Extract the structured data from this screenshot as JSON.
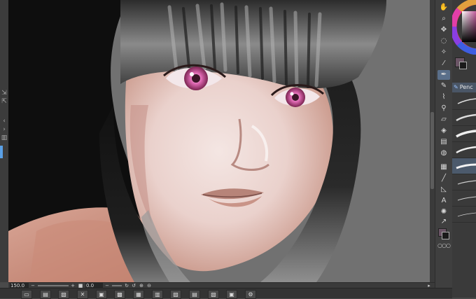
{
  "status_bar": {
    "zoom_value": "150.0",
    "rotation_value": "0.0"
  },
  "subtool": {
    "active_tab_label": "Penc",
    "group_icon": "pencil-icon"
  },
  "tools": [
    {
      "name": "hand-tool",
      "icon": "hand-icon",
      "glyph": "✋"
    },
    {
      "name": "zoom-tool",
      "icon": "magnifier-icon",
      "glyph": "⌕"
    },
    {
      "name": "move-tool",
      "icon": "move-icon",
      "glyph": "✥"
    },
    {
      "name": "lasso-tool",
      "icon": "lasso-icon",
      "glyph": "◌"
    },
    {
      "name": "magic-wand-tool",
      "icon": "wand-icon",
      "glyph": "✧"
    },
    {
      "name": "eyedropper-tool",
      "icon": "eyedropper-icon",
      "glyph": "⁄"
    },
    {
      "name": "pen-tool",
      "icon": "pen-icon",
      "glyph": "✒"
    },
    {
      "name": "pencil-tool",
      "icon": "pencil-icon",
      "glyph": "✎"
    },
    {
      "name": "brush-tool",
      "icon": "brush-icon",
      "glyph": "⌇"
    },
    {
      "name": "airbrush-tool",
      "icon": "airbrush-icon",
      "glyph": "⚲"
    },
    {
      "name": "eraser-tool",
      "icon": "eraser-icon",
      "glyph": "▱"
    },
    {
      "name": "fill-tool",
      "icon": "bucket-icon",
      "glyph": "◈"
    },
    {
      "name": "gradient-tool",
      "icon": "gradient-icon",
      "glyph": "▤"
    },
    {
      "name": "blend-tool",
      "icon": "blend-icon",
      "glyph": "◍"
    },
    {
      "name": "frame-tool",
      "icon": "frame-icon",
      "glyph": "▦"
    },
    {
      "name": "figure-tool",
      "icon": "figure-icon",
      "glyph": "╱"
    },
    {
      "name": "ruler-tool",
      "icon": "ruler-icon",
      "glyph": "◺"
    },
    {
      "name": "text-tool",
      "icon": "text-icon",
      "glyph": "A"
    },
    {
      "name": "balloon-tool",
      "icon": "balloon-icon",
      "glyph": "✺"
    },
    {
      "name": "correct-line-tool",
      "icon": "correct-line-icon",
      "glyph": "↗"
    }
  ],
  "colors": {
    "accent": "#5aa0e6",
    "main_color": "#6b5566",
    "sub_color": "#1a1a1a",
    "canvas_bg": "#717171",
    "iris": "#e06ab4"
  },
  "command_bar_icons": [
    "new-icon",
    "open-icon",
    "save-icon",
    "undo-icon",
    "redo-icon",
    "clear-icon",
    "fill-icon",
    "transform-icon",
    "layer-icon",
    "copy-icon",
    "paste-icon",
    "select-icon",
    "settings-icon",
    "scale-icon",
    "flip-icon",
    "filter-icon"
  ]
}
